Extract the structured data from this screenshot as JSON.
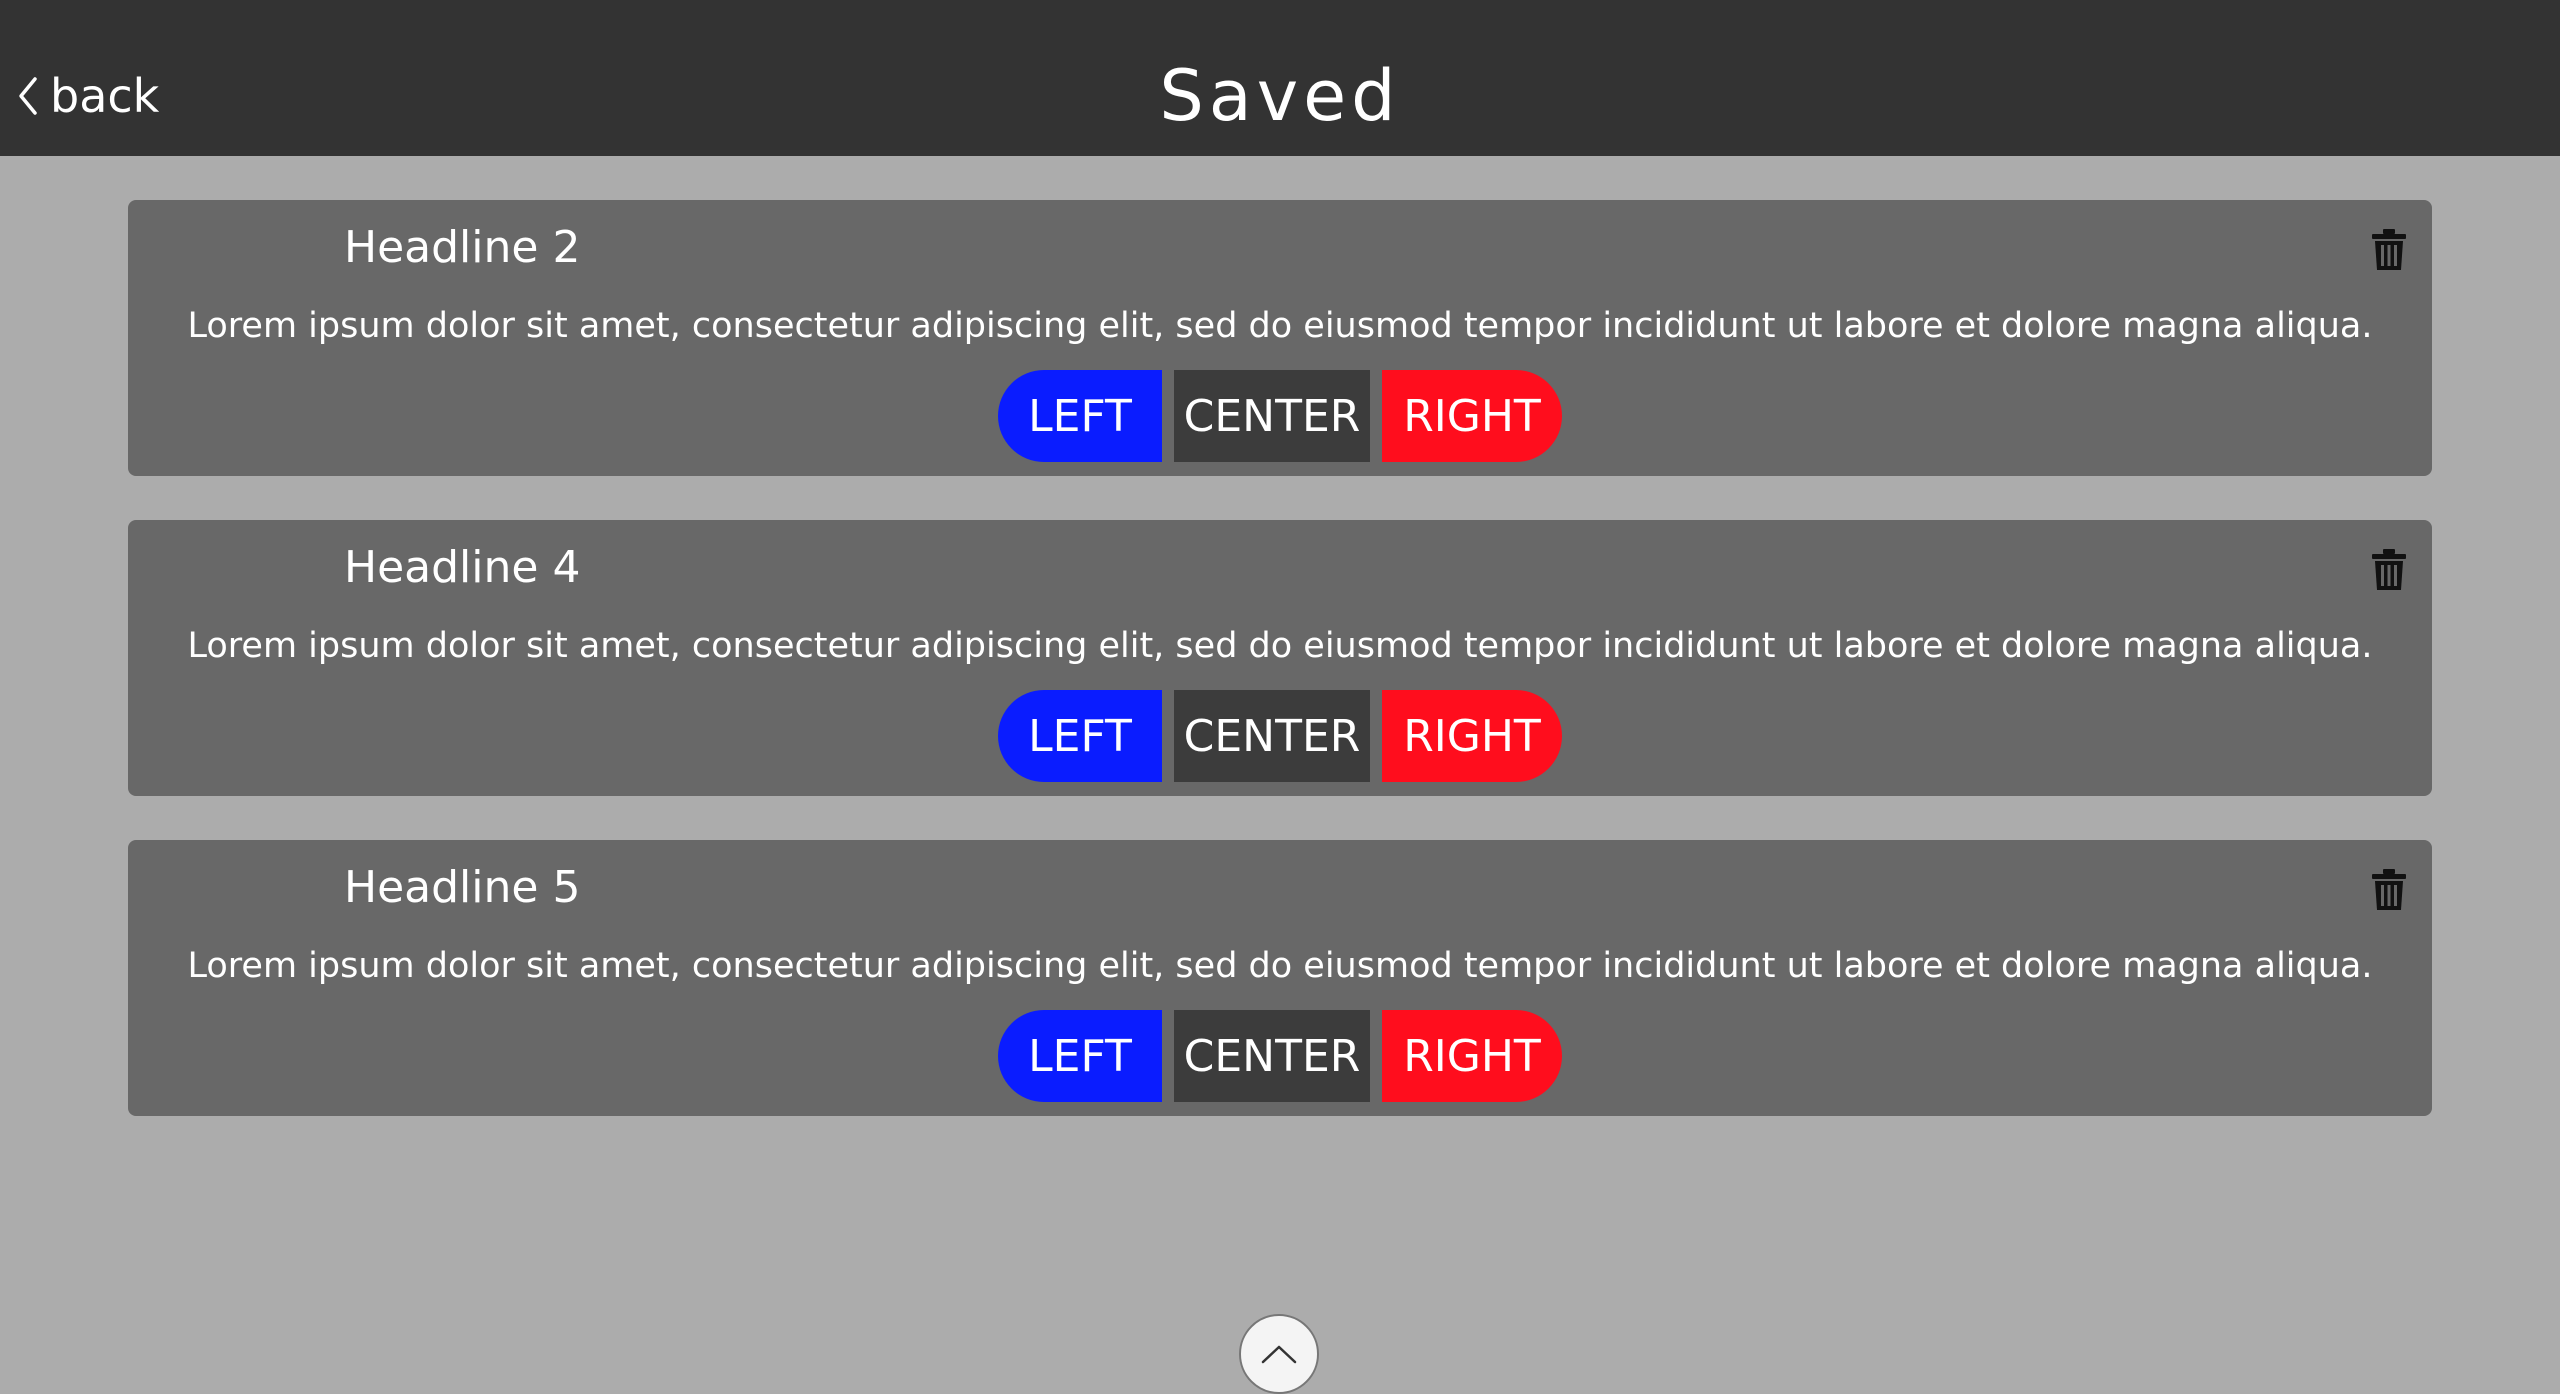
{
  "header": {
    "back_label": "back",
    "title": "Saved"
  },
  "cards": [
    {
      "headline": "Headline 2",
      "body": "Lorem ipsum dolor sit amet, consectetur adipiscing elit, sed do eiusmod tempor incididunt ut labore et dolore magna aliqua.",
      "left_label": "LEFT",
      "center_label": "CENTER",
      "right_label": "RIGHT"
    },
    {
      "headline": "Headline 4",
      "body": "Lorem ipsum dolor sit amet, consectetur adipiscing elit, sed do eiusmod tempor incididunt ut labore et dolore magna aliqua.",
      "left_label": "LEFT",
      "center_label": "CENTER",
      "right_label": "RIGHT"
    },
    {
      "headline": "Headline 5",
      "body": "Lorem ipsum dolor sit amet, consectetur adipiscing elit, sed do eiusmod tempor incididunt ut labore et dolore magna aliqua.",
      "left_label": "LEFT",
      "center_label": "CENTER",
      "right_label": "RIGHT"
    }
  ],
  "icons": {
    "back": "chevron-left-icon",
    "delete": "trash-icon",
    "scroll_top": "chevron-up-icon"
  },
  "colors": {
    "header_bg": "#333333",
    "page_bg": "#acacac",
    "card_bg": "#686868",
    "left_button": "#0a1cff",
    "center_button": "#3c3c3c",
    "right_button": "#ff0d1d"
  }
}
